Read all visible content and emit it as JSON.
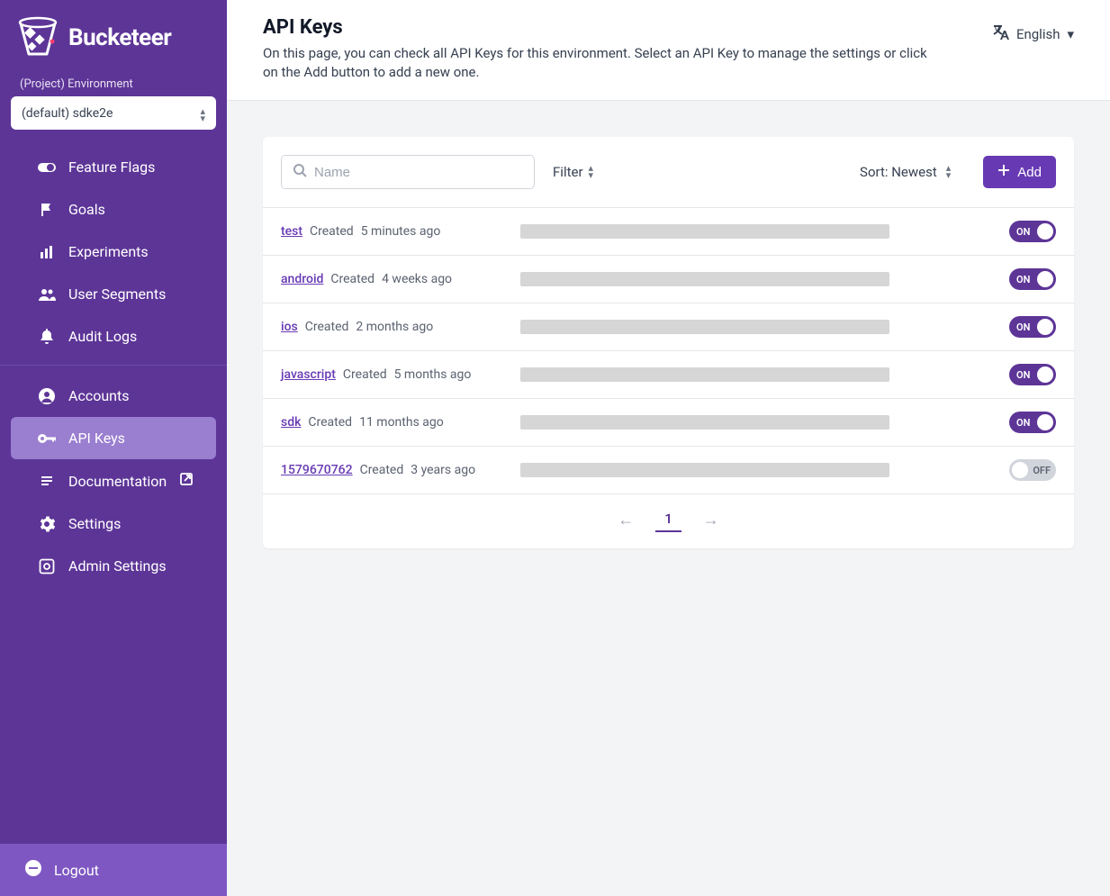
{
  "brand": {
    "name": "Bucketeer"
  },
  "env": {
    "label": "(Project) Environment",
    "selected": "(default) sdke2e"
  },
  "sidebar": {
    "group1": [
      {
        "key": "feature-flags",
        "label": "Feature Flags"
      },
      {
        "key": "goals",
        "label": "Goals"
      },
      {
        "key": "experiments",
        "label": "Experiments"
      },
      {
        "key": "user-segments",
        "label": "User Segments"
      },
      {
        "key": "audit-logs",
        "label": "Audit Logs"
      }
    ],
    "group2": [
      {
        "key": "accounts",
        "label": "Accounts"
      },
      {
        "key": "api-keys",
        "label": "API Keys",
        "active": true
      },
      {
        "key": "documentation",
        "label": "Documentation",
        "external": true
      },
      {
        "key": "settings",
        "label": "Settings"
      },
      {
        "key": "admin-settings",
        "label": "Admin Settings"
      }
    ],
    "logout": "Logout"
  },
  "header": {
    "title": "API Keys",
    "subtitle": "On this page, you can check all API Keys for this environment. Select an API Key to manage the settings or click on the Add button to add a new one.",
    "lang": "English"
  },
  "toolbar": {
    "search_placeholder": "Name",
    "filter": "Filter",
    "sort_label": "Sort:",
    "sort_value": "Newest",
    "add": "Add"
  },
  "rows": [
    {
      "name": "test",
      "created_label": "Created",
      "created_time": "5 minutes ago",
      "state": "ON"
    },
    {
      "name": "android",
      "created_label": "Created",
      "created_time": "4 weeks ago",
      "state": "ON"
    },
    {
      "name": "ios",
      "created_label": "Created",
      "created_time": "2 months ago",
      "state": "ON"
    },
    {
      "name": "javascript",
      "created_label": "Created",
      "created_time": "5 months ago",
      "state": "ON"
    },
    {
      "name": "sdk",
      "created_label": "Created",
      "created_time": "11 months ago",
      "state": "ON"
    },
    {
      "name": "1579670762",
      "created_label": "Created",
      "created_time": "3 years ago",
      "state": "OFF"
    }
  ],
  "pager": {
    "current": "1"
  },
  "labels": {
    "on": "ON",
    "off": "OFF"
  }
}
